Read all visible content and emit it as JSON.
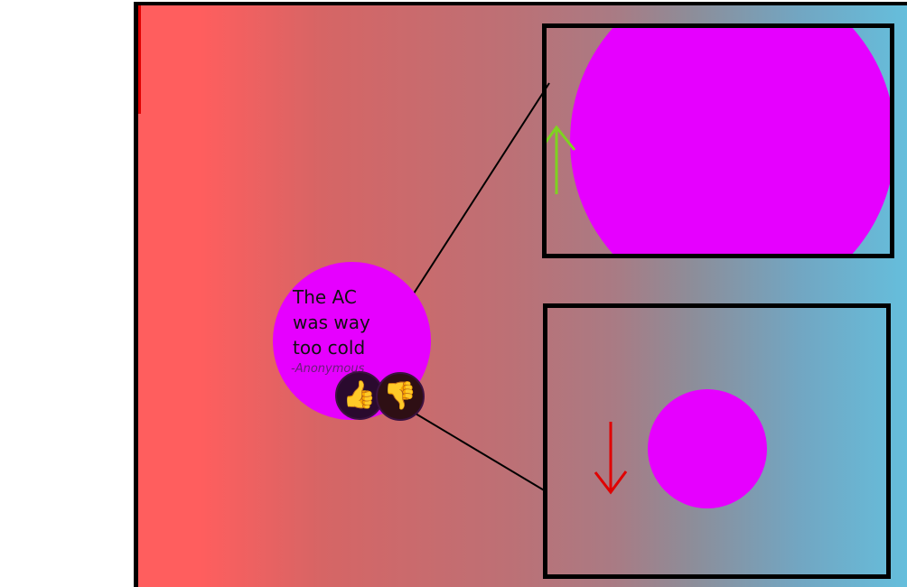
{
  "feedback": {
    "quote": "The AC was way too cold",
    "author": "-Anonymous",
    "thumbs_up_icon": "👍",
    "thumbs_down_icon": "👎"
  },
  "colors": {
    "bubble": "#e600ff",
    "up_arrow": "#7ed321",
    "down_arrow": "#e00000",
    "gradient_left": "#ff5e5e",
    "gradient_right": "#65bedc"
  },
  "icons": {
    "up_arrow": "arrow-up-icon",
    "down_arrow": "arrow-down-icon",
    "thumbs_up": "thumbs-up-icon",
    "thumbs_down": "thumbs-down-icon"
  }
}
